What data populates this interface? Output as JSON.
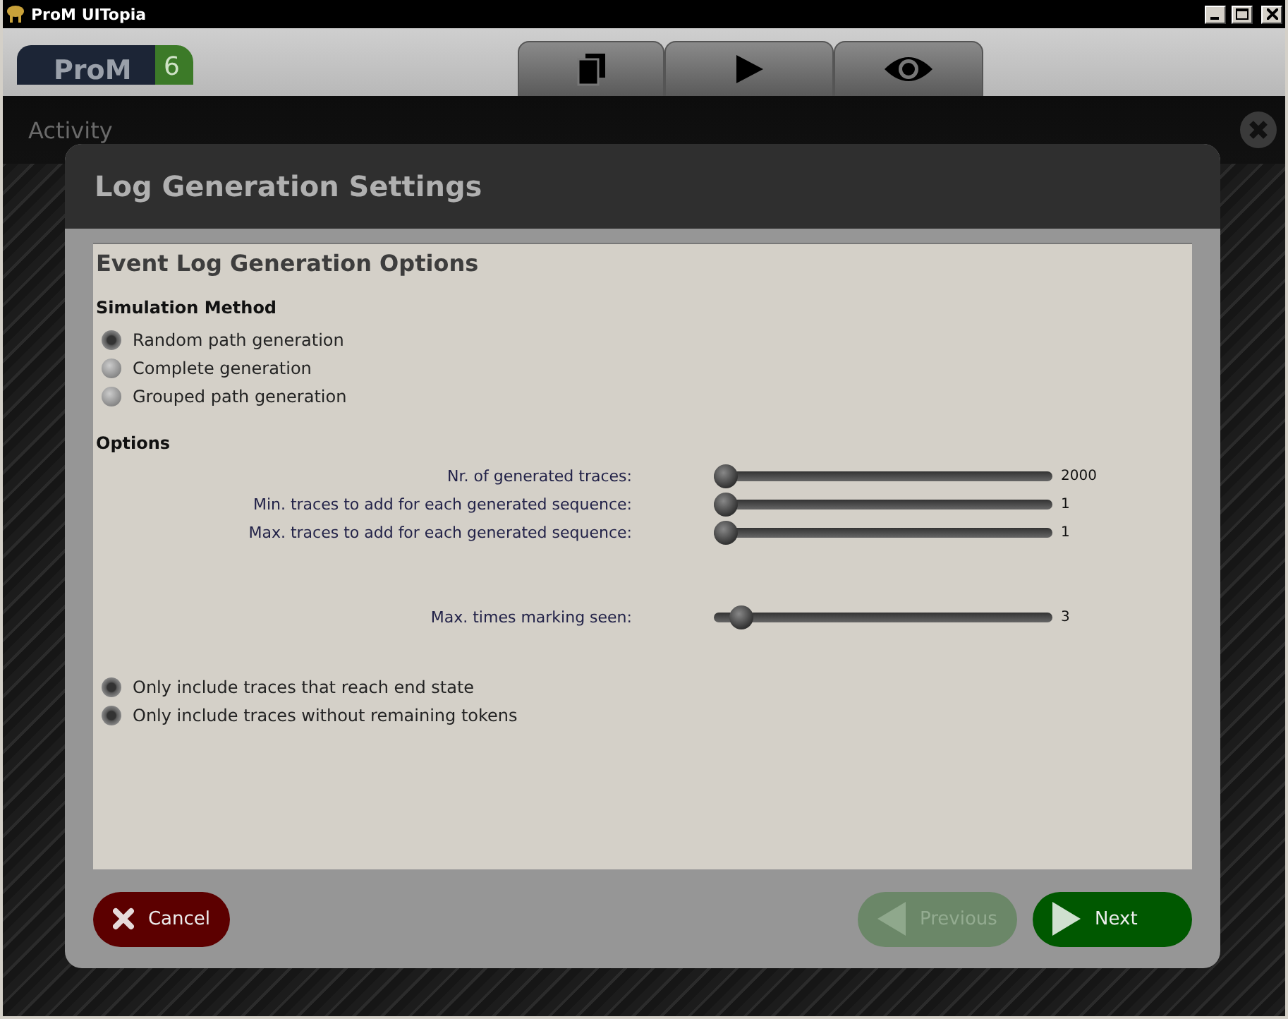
{
  "window": {
    "title": "ProM UITopia"
  },
  "logo": {
    "name": "ProM",
    "version": "6"
  },
  "tabs": [
    {
      "kind": "workspace"
    },
    {
      "kind": "actions"
    },
    {
      "kind": "views"
    }
  ],
  "activity": {
    "title": "Activity"
  },
  "dialog": {
    "title": "Log Generation Settings",
    "heading": "Event Log Generation Options",
    "simulation": {
      "heading": "Simulation Method",
      "options": [
        {
          "label": "Random path generation",
          "selected": true
        },
        {
          "label": "Complete generation",
          "selected": false
        },
        {
          "label": "Grouped path generation",
          "selected": false
        }
      ]
    },
    "options": {
      "heading": "Options",
      "slider_groups": [
        [
          {
            "label": "Nr. of generated traces:",
            "level": 0,
            "reading": "2000"
          },
          {
            "label": "Min. traces to add for each generated sequence:",
            "level": 0,
            "reading": "1"
          },
          {
            "label": "Max. traces to add for each generated sequence:",
            "level": 0,
            "reading": "1"
          }
        ],
        [
          {
            "label": "Max. times marking seen:",
            "level": 0.05,
            "reading": "3"
          }
        ]
      ]
    },
    "filters": [
      {
        "label": "Only include traces that reach end state",
        "checked": true
      },
      {
        "label": "Only include traces without remaining tokens",
        "checked": true
      }
    ],
    "buttons": [
      {
        "label": "Cancel",
        "kind": "cancel",
        "disabled": false
      },
      {
        "label": "Previous",
        "kind": "previous",
        "disabled": true
      },
      {
        "label": "Next",
        "kind": "next",
        "disabled": false
      }
    ]
  }
}
